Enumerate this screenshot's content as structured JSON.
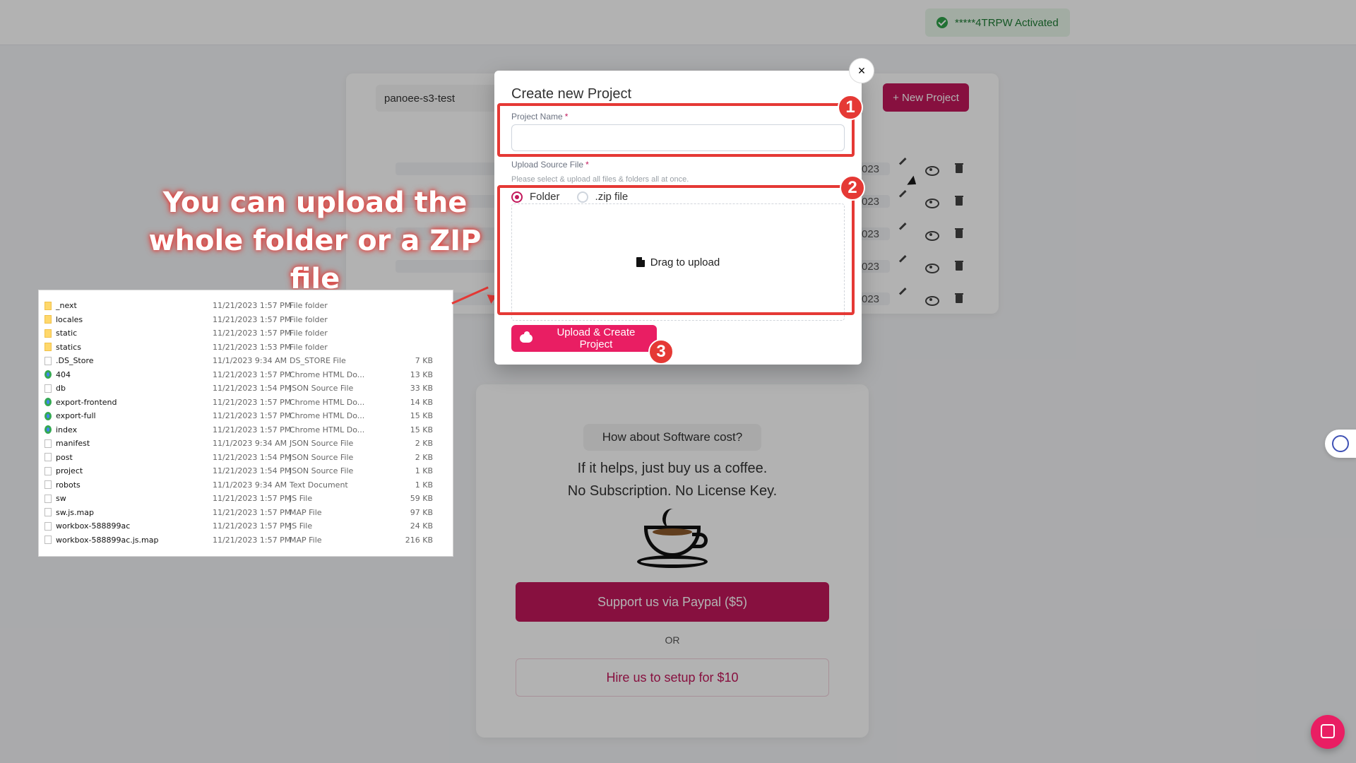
{
  "header": {
    "activated_text": "*****4TRPW Activated",
    "activated_icon": "check-circle-icon"
  },
  "background": {
    "bucket_name": "panoee-s3-test",
    "new_project_label": "+ New Project",
    "row_date_tail": "023"
  },
  "modal": {
    "title": "Create new Project",
    "close_label": "×",
    "project_name_label": "Project Name",
    "required_mark": "*",
    "project_name_value": "",
    "upload_source_label": "Upload Source File",
    "helper_text": "Please select & upload all files & folders all at once.",
    "radio_folder_label": "Folder",
    "radio_zip_label": ".zip file",
    "selected_option": "Folder",
    "dropzone_text": "Drag to upload",
    "upload_button_label": "Upload & Create Project"
  },
  "annotations": {
    "badge_1": "1",
    "badge_2": "2",
    "badge_3": "3",
    "big_text_line1": "You can upload the",
    "big_text_line2": "whole folder or a ZIP file"
  },
  "explorer": {
    "files": [
      {
        "name": "_next",
        "date": "11/21/2023 1:57 PM",
        "type": "File folder",
        "size": "",
        "icon": "folder"
      },
      {
        "name": "locales",
        "date": "11/21/2023 1:57 PM",
        "type": "File folder",
        "size": "",
        "icon": "folder"
      },
      {
        "name": "static",
        "date": "11/21/2023 1:57 PM",
        "type": "File folder",
        "size": "",
        "icon": "folder"
      },
      {
        "name": "statics",
        "date": "11/21/2023 1:53 PM",
        "type": "File folder",
        "size": "",
        "icon": "folder"
      },
      {
        "name": ".DS_Store",
        "date": "11/1/2023 9:34 AM",
        "type": "DS_STORE File",
        "size": "7 KB",
        "icon": "file"
      },
      {
        "name": "404",
        "date": "11/21/2023 1:57 PM",
        "type": "Chrome HTML Do...",
        "size": "13 KB",
        "icon": "chrome"
      },
      {
        "name": "db",
        "date": "11/21/2023 1:54 PM",
        "type": "JSON Source File",
        "size": "33 KB",
        "icon": "file"
      },
      {
        "name": "export-frontend",
        "date": "11/21/2023 1:57 PM",
        "type": "Chrome HTML Do...",
        "size": "14 KB",
        "icon": "chrome"
      },
      {
        "name": "export-full",
        "date": "11/21/2023 1:57 PM",
        "type": "Chrome HTML Do...",
        "size": "15 KB",
        "icon": "chrome"
      },
      {
        "name": "index",
        "date": "11/21/2023 1:57 PM",
        "type": "Chrome HTML Do...",
        "size": "15 KB",
        "icon": "chrome"
      },
      {
        "name": "manifest",
        "date": "11/1/2023 9:34 AM",
        "type": "JSON Source File",
        "size": "2 KB",
        "icon": "file"
      },
      {
        "name": "post",
        "date": "11/21/2023 1:54 PM",
        "type": "JSON Source File",
        "size": "2 KB",
        "icon": "file"
      },
      {
        "name": "project",
        "date": "11/21/2023 1:54 PM",
        "type": "JSON Source File",
        "size": "1 KB",
        "icon": "file"
      },
      {
        "name": "robots",
        "date": "11/1/2023 9:34 AM",
        "type": "Text Document",
        "size": "1 KB",
        "icon": "file"
      },
      {
        "name": "sw",
        "date": "11/21/2023 1:57 PM",
        "type": "JS File",
        "size": "59 KB",
        "icon": "file"
      },
      {
        "name": "sw.js.map",
        "date": "11/21/2023 1:57 PM",
        "type": "MAP File",
        "size": "97 KB",
        "icon": "file"
      },
      {
        "name": "workbox-588899ac",
        "date": "11/21/2023 1:57 PM",
        "type": "JS File",
        "size": "24 KB",
        "icon": "file"
      },
      {
        "name": "workbox-588899ac.js.map",
        "date": "11/21/2023 1:57 PM",
        "type": "MAP File",
        "size": "216 KB",
        "icon": "file"
      }
    ]
  },
  "coffee_card": {
    "pill": "How about Software cost?",
    "line1": "If it helps, just buy us a coffee.",
    "line2": "No Subscription. No License Key.",
    "paypal_label": "Support us via Paypal ($5)",
    "or_label": "OR",
    "hire_label": "Hire us to setup for $10"
  },
  "colors": {
    "accent": "#c2185b",
    "accent_bright": "#e91e63",
    "annotation_red": "#e53935"
  }
}
